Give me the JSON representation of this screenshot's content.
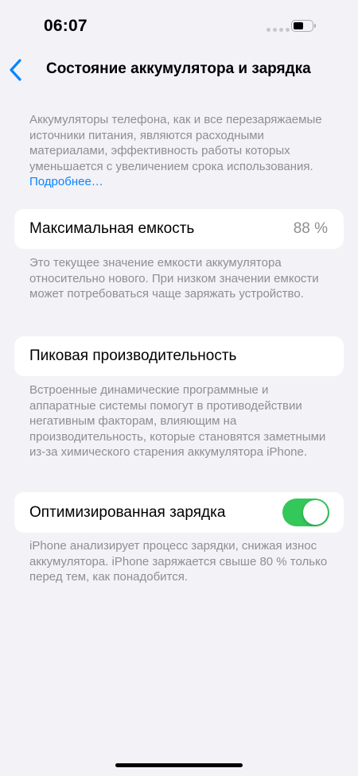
{
  "status_bar": {
    "time": "06:07"
  },
  "nav": {
    "back_icon": "chevron-left-icon",
    "title": "Состояние аккумулятора и зарядка"
  },
  "intro": {
    "text": "Аккумуляторы телефона, как и все перезаряжаемые источники питания, являются расходными материалами, эффективность работы которых уменьшается с увеличением срока использования.",
    "link": "Подробнее…"
  },
  "max_capacity": {
    "label": "Максимальная емкость",
    "value": "88 %",
    "footer": "Это текущее значение емкости аккумулятора относительно нового. При низком значении емкости может потребоваться чаще заряжать устройство."
  },
  "peak_performance": {
    "label": "Пиковая производительность",
    "footer": "Встроенные динамические программные и аппаратные системы помогут в противодействии негативным факторам, влияющим на производительность, которые становятся заметными из-за химического старения аккумулятора iPhone."
  },
  "optimized_charging": {
    "label": "Оптимизированная зарядка",
    "enabled": true,
    "footer": "iPhone анализирует процесс зарядки, снижая износ аккумулятора. iPhone заряжается свыше 80 % только перед тем, как понадобится."
  },
  "colors": {
    "accent": "#0a84ff",
    "toggle_on": "#34c759",
    "background": "#f2f2f7",
    "secondary_text": "#8e8e93"
  }
}
